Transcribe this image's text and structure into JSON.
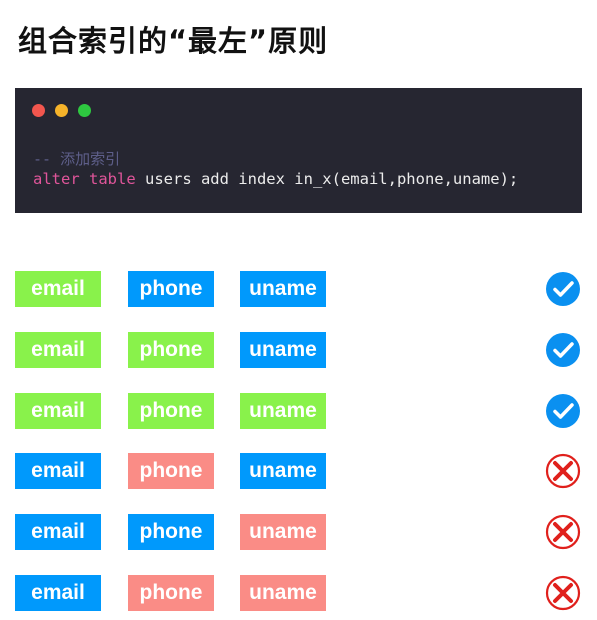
{
  "title": "组合索引的“最左”原则",
  "code_window": {
    "dots": [
      "#f2564e",
      "#f6b32a",
      "#2ec840"
    ],
    "comment": "-- 添加索引",
    "keyword": "alter table",
    "statement": " users add index in_x(email,phone,uname);"
  },
  "colors": {
    "used": "#89f24b",
    "unused": "#0099fc",
    "broken": "#fa8c86",
    "check": "#0a90f0",
    "cross": "#e0201c"
  },
  "rows": [
    {
      "fields": [
        {
          "label": "email",
          "state": "used"
        },
        {
          "label": "phone",
          "state": "unused"
        },
        {
          "label": "uname",
          "state": "unused"
        }
      ],
      "result": "check"
    },
    {
      "fields": [
        {
          "label": "email",
          "state": "used"
        },
        {
          "label": "phone",
          "state": "used"
        },
        {
          "label": "uname",
          "state": "unused"
        }
      ],
      "result": "check"
    },
    {
      "fields": [
        {
          "label": "email",
          "state": "used"
        },
        {
          "label": "phone",
          "state": "used"
        },
        {
          "label": "uname",
          "state": "used"
        }
      ],
      "result": "check"
    },
    {
      "fields": [
        {
          "label": "email",
          "state": "unused"
        },
        {
          "label": "phone",
          "state": "broken"
        },
        {
          "label": "uname",
          "state": "unused"
        }
      ],
      "result": "cross"
    },
    {
      "fields": [
        {
          "label": "email",
          "state": "unused"
        },
        {
          "label": "phone",
          "state": "unused"
        },
        {
          "label": "uname",
          "state": "broken"
        }
      ],
      "result": "cross"
    },
    {
      "fields": [
        {
          "label": "email",
          "state": "unused"
        },
        {
          "label": "phone",
          "state": "broken"
        },
        {
          "label": "uname",
          "state": "broken"
        }
      ],
      "result": "cross"
    }
  ]
}
